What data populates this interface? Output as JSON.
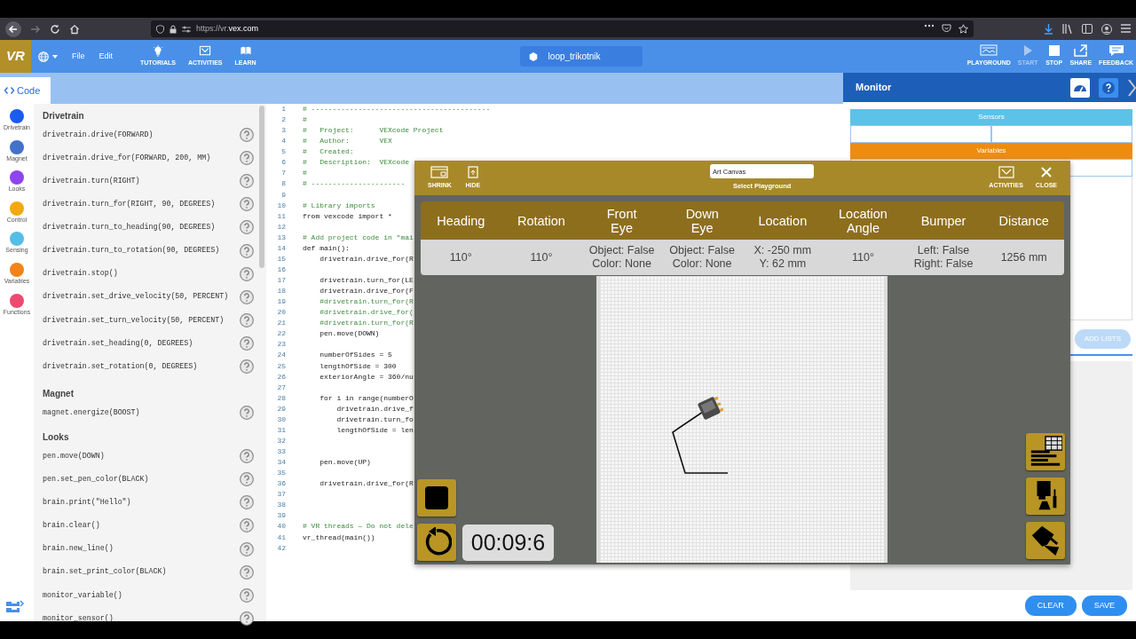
{
  "browser": {
    "url": "https://vr.**vex.com**"
  },
  "app_bar": {
    "logo": "VR",
    "menus": [
      "File",
      "Edit"
    ],
    "tools": [
      "TUTORIALS",
      "ACTIVITIES",
      "LEARN"
    ],
    "project_name": "loop_trikotnik",
    "actions": [
      {
        "label": "PLAYGROUND",
        "disabled": false
      },
      {
        "label": "START",
        "disabled": true
      },
      {
        "label": "STOP",
        "disabled": false
      },
      {
        "label": "SHARE",
        "disabled": false
      },
      {
        "label": "FEEDBACK",
        "disabled": false
      }
    ]
  },
  "tabs": [
    {
      "label": "Code",
      "selected": true
    }
  ],
  "categories": [
    {
      "label": "Drivetrain",
      "color": "#1a5cf0"
    },
    {
      "label": "Magnet",
      "color": "#4471c9"
    },
    {
      "label": "Looks",
      "color": "#8f45ee"
    },
    {
      "label": "Control",
      "color": "#f2a90f"
    },
    {
      "label": "Sensing",
      "color": "#55bee6"
    },
    {
      "label": "Variables",
      "color": "#f08418"
    },
    {
      "label": "Functions",
      "color": "#ec4a70"
    }
  ],
  "palette": [
    {
      "title": "Drivetrain",
      "commands": [
        "drivetrain.drive(FORWARD)",
        "drivetrain.drive_for(FORWARD, 200, MM)",
        "drivetrain.turn(RIGHT)",
        "drivetrain.turn_for(RIGHT, 90, DEGREES)",
        "drivetrain.turn_to_heading(90, DEGREES)",
        "drivetrain.turn_to_rotation(90, DEGREES)",
        "drivetrain.stop()",
        "drivetrain.set_drive_velocity(50, PERCENT)",
        "drivetrain.set_turn_velocity(50, PERCENT)",
        "drivetrain.set_heading(0, DEGREES)",
        "drivetrain.set_rotation(0, DEGREES)"
      ]
    },
    {
      "title": "Magnet",
      "commands": [
        "magnet.energize(BOOST)"
      ]
    },
    {
      "title": "Looks",
      "commands": [
        "pen.move(DOWN)",
        "pen.set_pen_color(BLACK)",
        "brain.print(\"Hello\")",
        "brain.clear()",
        "brain.new_line()",
        "brain.set_print_color(BLACK)",
        "monitor_variable()",
        "monitor_sensor()"
      ]
    }
  ],
  "editor": {
    "lines": [
      {
        "number": "1",
        "text": "# ------------------------------------------",
        "kind": "comment"
      },
      {
        "number": "2",
        "text": "#",
        "kind": "comment"
      },
      {
        "number": "3",
        "text": "#   Project:      VEXcode Project",
        "kind": "comment"
      },
      {
        "number": "4",
        "text": "#   Author:       VEX",
        "kind": "comment"
      },
      {
        "number": "5",
        "text": "#   Created:",
        "kind": "comment"
      },
      {
        "number": "6",
        "text": "#   Description:  VEXcode",
        "kind": "comment"
      },
      {
        "number": "7",
        "text": "#",
        "kind": "comment"
      },
      {
        "number": "8",
        "text": "# ----------------------",
        "kind": "comment"
      },
      {
        "number": "9"
      },
      {
        "number": "10",
        "text": "# Library imports",
        "kind": "comment"
      },
      {
        "number": "11",
        "text": "from vexcode import *",
        "kind": "code"
      },
      {
        "number": "12"
      },
      {
        "number": "13",
        "text": "# Add project code in \"mai",
        "kind": "comment"
      },
      {
        "number": "14",
        "text": "def main():",
        "kind": "code"
      },
      {
        "number": "15",
        "text": "    drivetrain.drive_for(R",
        "kind": "code"
      },
      {
        "number": "16"
      },
      {
        "number": "17",
        "text": "    drivetrain.turn_for(LE",
        "kind": "code"
      },
      {
        "number": "18",
        "text": "    drivetrain.drive_for(F",
        "kind": "code"
      },
      {
        "number": "19",
        "text": "    #drivetrain.turn_for(R",
        "kind": "comment"
      },
      {
        "number": "20",
        "text": "    #drivetrain.drive_for(",
        "kind": "comment"
      },
      {
        "number": "21",
        "text": "    #drivetrain.turn_for(R",
        "kind": "comment"
      },
      {
        "number": "22",
        "text": "    pen.move(DOWN)",
        "kind": "code"
      },
      {
        "number": "23"
      },
      {
        "number": "24",
        "text": "    numberOfSides = 5",
        "kind": "code"
      },
      {
        "number": "25",
        "text": "    lengthOfSide = 300",
        "kind": "code"
      },
      {
        "number": "26",
        "text": "    exteriorAngle = 360/nu",
        "kind": "code"
      },
      {
        "number": "27"
      },
      {
        "number": "28",
        "text": "    for i in range(numberO",
        "kind": "code"
      },
      {
        "number": "29",
        "text": "        drivetrain.drive_f",
        "kind": "code"
      },
      {
        "number": "30",
        "text": "        drivetrain.turn_fo",
        "kind": "code"
      },
      {
        "number": "31",
        "text": "        lengthOfSide = len",
        "kind": "code"
      },
      {
        "number": "32"
      },
      {
        "number": "33"
      },
      {
        "number": "34",
        "text": "    pen.move(UP)",
        "kind": "code"
      },
      {
        "number": "35"
      },
      {
        "number": "36",
        "text": "    drivetrain.drive_for(R",
        "kind": "code"
      },
      {
        "number": "37"
      },
      {
        "number": "38"
      },
      {
        "number": "39"
      },
      {
        "number": "40",
        "text": "# VR threads — Do not dele",
        "kind": "comment"
      },
      {
        "number": "41",
        "text": "vr_thread(main())",
        "kind": "code"
      },
      {
        "number": "42"
      }
    ]
  },
  "monitor": {
    "title": "Monitor",
    "sections": [
      {
        "title": "Sensors",
        "color": "#5cc2e8"
      },
      {
        "title": "Variables",
        "color": "#ef8c10"
      }
    ],
    "add_lists": {
      "label": "ADD LISTS",
      "disabled": true
    },
    "buttons": [
      "CLEAR",
      "SAVE"
    ]
  },
  "playground": {
    "left_controls": [
      "SHRINK",
      "HIDE"
    ],
    "select": {
      "value": "Art Canvas",
      "label": "Select Playground"
    },
    "right_controls": [
      "ACTIVITIES",
      "CLOSE"
    ],
    "sensors": [
      {
        "header": [
          "Heading"
        ],
        "value": [
          "110°"
        ]
      },
      {
        "header": [
          "Rotation"
        ],
        "value": [
          "110°"
        ]
      },
      {
        "header": [
          "Front",
          "Eye"
        ],
        "value": [
          "Object: False",
          "Color: None"
        ]
      },
      {
        "header": [
          "Down",
          "Eye"
        ],
        "value": [
          "Object: False",
          "Color: None"
        ]
      },
      {
        "header": [
          "Location"
        ],
        "value": [
          "X: -250 mm",
          "Y: 62 mm"
        ]
      },
      {
        "header": [
          "Location",
          "Angle"
        ],
        "value": [
          "110°"
        ]
      },
      {
        "header": [
          "Bumper"
        ],
        "value": [
          "Left: False",
          "Right: False"
        ]
      },
      {
        "header": [
          "Distance"
        ],
        "value": [
          "1256 mm"
        ]
      }
    ],
    "timer": "00:09:6"
  }
}
